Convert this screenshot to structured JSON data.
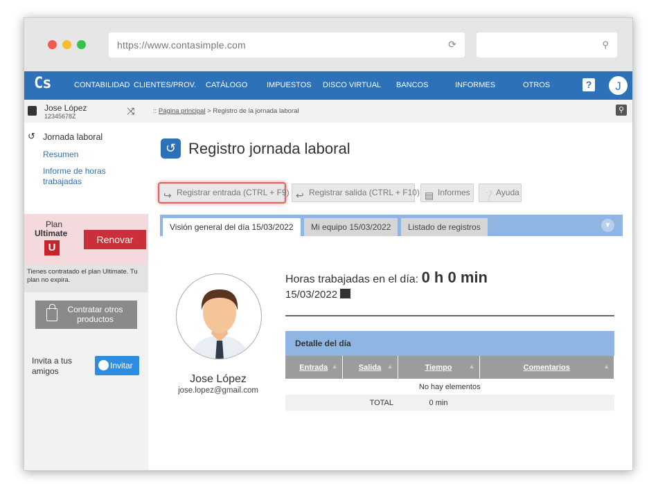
{
  "browser": {
    "url": "https://www.contasimple.com"
  },
  "nav": {
    "logo": "Cs",
    "items": [
      "CONTABILIDAD",
      "CLIENTES/PROV.",
      "CATÁLOGO",
      "IMPUESTOS",
      "DISCO VIRTUAL",
      "BANCOS",
      "INFORMES",
      "OTROS"
    ],
    "help": "?",
    "avatar": "J"
  },
  "sidebar": {
    "user_name": "Jose López",
    "user_id": "12345678Z",
    "section_title": "Jornada laboral",
    "links": [
      "Resumen",
      "Informe de horas trabajadas"
    ],
    "plan_label": "Plan",
    "plan_name": "Ultimate",
    "plan_badge": "U",
    "renew_label": "Renovar",
    "plan_note": "Tienes contratado el plan Ultimate. Tu plan no expira.",
    "contract_label": "Contratar otros productos",
    "invite_text": "Invita a tus amigos",
    "invite_button": "Invitar"
  },
  "breadcrumb": {
    "prefix": ":: ",
    "home": "Página principal",
    "current": " > Registro de la jornada laboral"
  },
  "page": {
    "title": "Registro jornada laboral"
  },
  "toolbar": {
    "entrada": "Registrar entrada (CTRL + F9)",
    "salida": "Registrar salida (CTRL + F10)",
    "informes": "Informes",
    "ayuda": "Ayuda"
  },
  "tabs": [
    "Visión general del día 15/03/2022",
    "Mi equipo 15/03/2022",
    "Listado de registros"
  ],
  "employee": {
    "name": "Jose López",
    "email": "jose.lopez@gmail.com"
  },
  "summary": {
    "hours_label": "Horas trabajadas en el día:",
    "hours_value": "0 h 0 min",
    "date": "15/03/2022"
  },
  "detail": {
    "title": "Detalle del día",
    "columns": [
      "Entrada",
      "Salida",
      "Tiempo",
      "Comentarios"
    ],
    "empty_text": "No hay elementos",
    "total_label": "TOTAL",
    "total_value": "0 min"
  },
  "colors": {
    "brand": "#2d72b8",
    "tabbar": "#8fb5e3",
    "renew": "#c9303a"
  }
}
